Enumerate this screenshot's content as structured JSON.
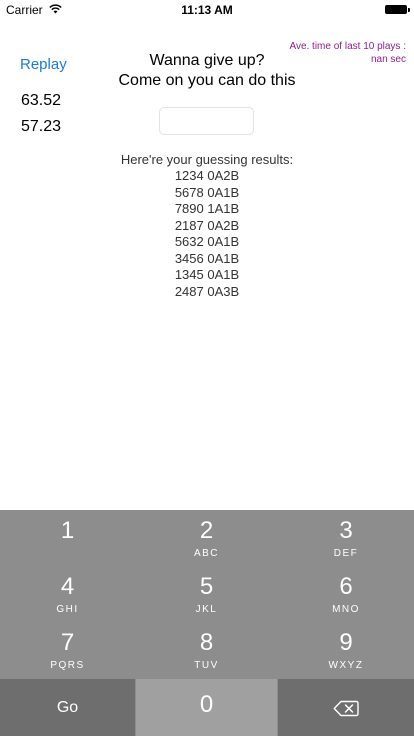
{
  "status_bar": {
    "carrier": "Carrier",
    "time": "11:13 AM"
  },
  "replay_label": "Replay",
  "times": [
    "63.52",
    "57.23"
  ],
  "avg_label": "Ave. time of last 10 plays : nan sec",
  "prompt": {
    "line1": "Wanna give up?",
    "line2": "Come on you can do this"
  },
  "guess_input": {
    "value": "",
    "placeholder": ""
  },
  "results_title": "Here're your guessing results:",
  "results": [
    "1234 0A2B",
    "5678 0A1B",
    "7890 1A1B",
    "2187 0A2B",
    "5632 0A1B",
    "3456 0A1B",
    "1345 0A1B",
    "2487 0A3B"
  ],
  "keypad": {
    "keys": [
      {
        "num": "1",
        "sub": ""
      },
      {
        "num": "2",
        "sub": "ABC"
      },
      {
        "num": "3",
        "sub": "DEF"
      },
      {
        "num": "4",
        "sub": "GHI"
      },
      {
        "num": "5",
        "sub": "JKL"
      },
      {
        "num": "6",
        "sub": "MNO"
      },
      {
        "num": "7",
        "sub": "PQRS"
      },
      {
        "num": "8",
        "sub": "TUV"
      },
      {
        "num": "9",
        "sub": "WXYZ"
      }
    ],
    "go_label": "Go",
    "zero": "0",
    "backspace_icon": "backspace-icon"
  },
  "colors": {
    "accent": "#1a7bd8",
    "avg_text": "#8e1d8e",
    "keypad_bg": "#8d8d8d",
    "key_dark": "#6e6e6e",
    "key_zero": "#a0a0a0"
  }
}
